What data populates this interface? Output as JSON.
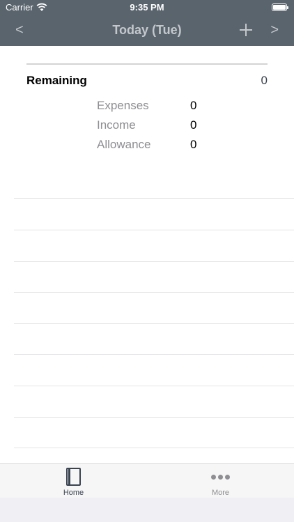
{
  "status_bar": {
    "carrier": "Carrier",
    "time": "9:35 PM"
  },
  "nav": {
    "title": "Today (Tue)",
    "prev_label": "<",
    "next_label": ">",
    "add_icon": "plus-icon"
  },
  "summary": {
    "remaining_label": "Remaining",
    "remaining_value": "0",
    "rows": [
      {
        "label": "Expenses",
        "value": "0"
      },
      {
        "label": "Income",
        "value": "0"
      },
      {
        "label": "Allowance",
        "value": "0"
      }
    ]
  },
  "tabs": [
    {
      "label": "Home",
      "icon": "book-icon",
      "selected": true
    },
    {
      "label": "More",
      "icon": "more-dots-icon",
      "selected": false
    }
  ],
  "colors": {
    "nav_bg": "#5a646d",
    "nav_text": "#c4c8cc",
    "accent": "#3a4350",
    "secondary_text": "#8e8e93"
  }
}
